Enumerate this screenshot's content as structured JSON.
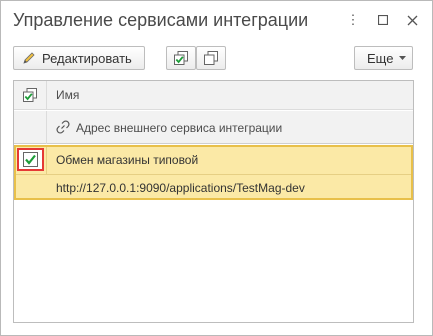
{
  "window": {
    "title": "Управление сервисами интеграции"
  },
  "toolbar": {
    "edit_label": "Редактировать",
    "more_label": "Еще"
  },
  "table": {
    "headers": {
      "name": "Имя",
      "address": "Адрес внешнего сервиса интеграции"
    },
    "rows": [
      {
        "checked": true,
        "name": "Обмен магазины типовой",
        "address": "http://127.0.0.1:9090/applications/TestMag-dev"
      }
    ]
  },
  "colors": {
    "selected_row": "#fbe9a6",
    "selection_border": "#e8c04a",
    "checkbox_focus": "#e53935",
    "check_green": "#1e9e3a",
    "header_bg": "#f2f2f2"
  }
}
